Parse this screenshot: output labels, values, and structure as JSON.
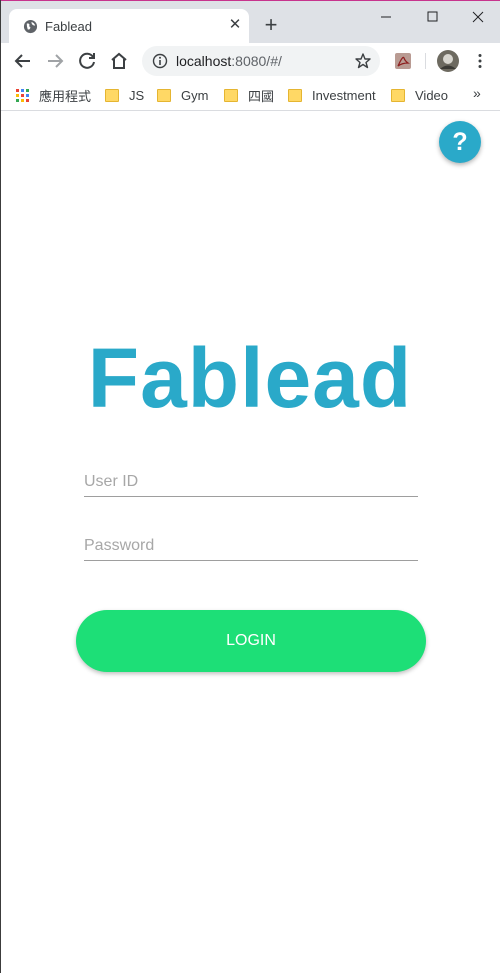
{
  "browser": {
    "tab": {
      "title": "Fablead",
      "close": "✕"
    },
    "new_tab": "+",
    "omnibox": {
      "host": "localhost",
      "path": ":8080/#/"
    },
    "bookmarks": [
      {
        "label": "應用程式",
        "type": "apps"
      },
      {
        "label": "JS",
        "type": "folder"
      },
      {
        "label": "Gym",
        "type": "folder"
      },
      {
        "label": "四國",
        "type": "folder"
      },
      {
        "label": "Investment",
        "type": "folder"
      },
      {
        "label": "Video",
        "type": "folder"
      }
    ],
    "bookmarks_more": "»"
  },
  "page": {
    "help_label": "?",
    "logo_text": "Fablead",
    "user_placeholder": "User ID",
    "password_placeholder": "Password",
    "login_label": "LOGIN"
  },
  "colors": {
    "brand": "#2aa9c9",
    "login": "#1ddf77"
  }
}
